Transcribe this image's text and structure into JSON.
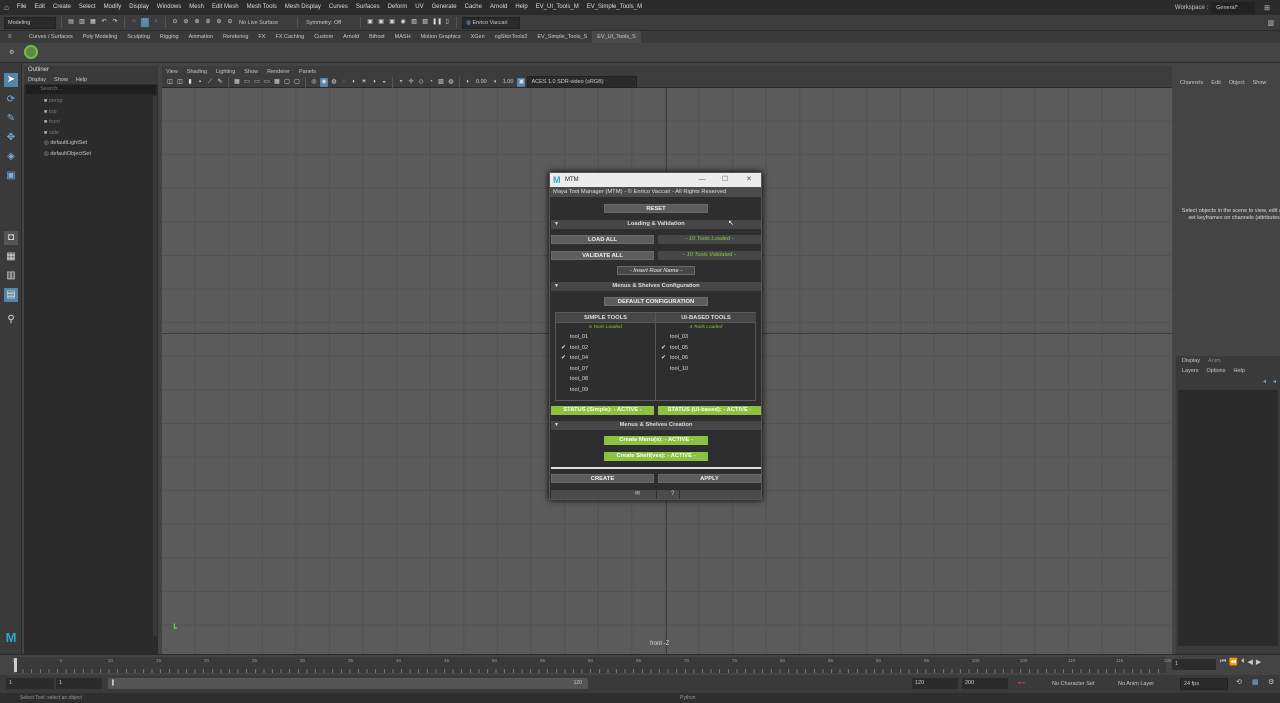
{
  "menubar": {
    "items": [
      "File",
      "Edit",
      "Create",
      "Select",
      "Modify",
      "Display",
      "Windows",
      "Mesh",
      "Edit Mesh",
      "Mesh Tools",
      "Mesh Display",
      "Curves",
      "Surfaces",
      "Deform",
      "UV",
      "Generate",
      "Cache",
      "Arnold",
      "Help",
      "EV_UI_Tools_M",
      "EV_Simple_Tools_M"
    ],
    "workspace_label": "Workspace :",
    "workspace_value": "General*"
  },
  "statusline": {
    "mode": "Modeling",
    "live_surface": "No Live Surface",
    "symmetry": "Symmetry: Off",
    "user": "Enrico Vaccari"
  },
  "shelf": {
    "tabs": [
      "Curves / Surfaces",
      "Poly Modeling",
      "Sculpting",
      "Rigging",
      "Animation",
      "Rendering",
      "FX",
      "FX Caching",
      "Custom",
      "Arnold",
      "Bifrost",
      "MASH",
      "Motion Graphics",
      "XGen",
      "ngSkinTools2",
      "EV_Simple_Tools_S",
      "EV_UI_Tools_S"
    ]
  },
  "outliner": {
    "title": "Outliner",
    "menu": [
      "Display",
      "Show",
      "Help"
    ],
    "search_placeholder": "Search...",
    "items": [
      {
        "label": "persp",
        "dim": true
      },
      {
        "label": "top",
        "dim": true
      },
      {
        "label": "front",
        "dim": true
      },
      {
        "label": "side",
        "dim": true
      },
      {
        "label": "defaultLightSet",
        "dim": false
      },
      {
        "label": "defaultObjectSet",
        "dim": false
      }
    ]
  },
  "viewport": {
    "menu": [
      "View",
      "Shading",
      "Lighting",
      "Show",
      "Renderer",
      "Panels"
    ],
    "exposure": "0.00",
    "gamma": "1.00",
    "colorspace": "ACES 1.0 SDR-video (sRGB)",
    "camera": "front -Z"
  },
  "channelbox": {
    "menu": [
      "Channels",
      "Edit",
      "Object",
      "Show"
    ],
    "hint": "Select objects in the scene to view, edit and set keyframes on channels (attributes)"
  },
  "layers": {
    "tabs": [
      "Display",
      "Anim"
    ],
    "menu": [
      "Layers",
      "Options",
      "Help"
    ]
  },
  "timeline": {
    "ticks": [
      "1",
      "5",
      "10",
      "15",
      "20",
      "25",
      "30",
      "35",
      "40",
      "45",
      "50",
      "55",
      "60",
      "65",
      "70",
      "75",
      "80",
      "85",
      "90",
      "95",
      "100",
      "105",
      "110",
      "115",
      "120"
    ],
    "current": "1"
  },
  "range": {
    "start": "1",
    "start2": "1",
    "slider_end": "120",
    "end": "120",
    "end2": "200",
    "character_set": "No Character Set",
    "anim_layer": "No Anim Layer",
    "fps": "24 fps"
  },
  "cmdline": {
    "text": "Select Tool: select an object",
    "lang": "Python"
  },
  "mtm": {
    "title": "MTM",
    "subtitle": "Maya Tool Manager (MTM) - © Enrico Vaccari - All Rights Reserved",
    "reset": "RESET",
    "section_loading": "Loading & Validation",
    "load_all": "LOAD ALL",
    "loaded_status": "- 10 Tools Loaded -",
    "validate_all": "VALIDATE ALL",
    "validated_status": "- 10 Tools Validated -",
    "root_name": "- Insert Root Name -",
    "section_menus": "Menus & Shelves Configuration",
    "default_config": "DEFAULT CONFIGURATION",
    "simple": {
      "header": "SIMPLE TOOLS",
      "sub": "6 Tools Loaded",
      "tools": [
        {
          "name": "tool_01",
          "checked": false
        },
        {
          "name": "tool_02",
          "checked": true
        },
        {
          "name": "tool_04",
          "checked": true
        },
        {
          "name": "tool_07",
          "checked": false
        },
        {
          "name": "tool_08",
          "checked": false
        },
        {
          "name": "tool_09",
          "checked": false
        }
      ]
    },
    "ui": {
      "header": "UI-BASED TOOLS",
      "sub": "4 Tools Loaded",
      "tools": [
        {
          "name": "tool_03",
          "checked": false
        },
        {
          "name": "tool_05",
          "checked": true
        },
        {
          "name": "tool_06",
          "checked": true
        },
        {
          "name": "tool_10",
          "checked": false
        }
      ]
    },
    "status_simple": "STATUS (Simple): - ACTIVE -",
    "status_ui": "STATUS (UI-based): - ACTIVE -",
    "section_creation": "Menus & Shelves Creation",
    "create_menus": "Create Menu(s): - ACTIVE -",
    "create_shelves": "Create Shelf(ves): - ACTIVE -",
    "create": "CREATE",
    "apply": "APPLY",
    "mail_icon": "✉",
    "help_icon": "?",
    "accent": "#8cc040"
  }
}
